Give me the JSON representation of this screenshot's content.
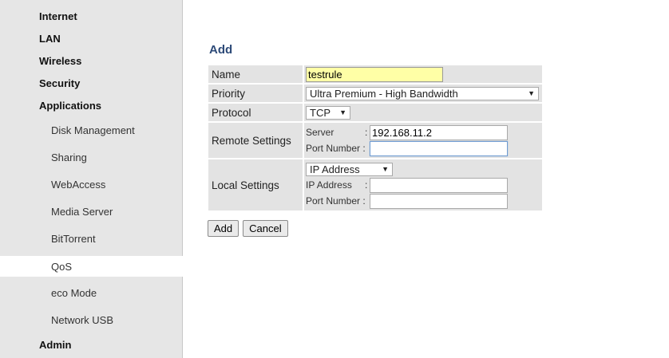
{
  "sidebar": {
    "items": [
      {
        "label": "Internet",
        "level": "top"
      },
      {
        "label": "LAN",
        "level": "top"
      },
      {
        "label": "Wireless",
        "level": "top"
      },
      {
        "label": "Security",
        "level": "top"
      },
      {
        "label": "Applications",
        "level": "top"
      },
      {
        "label": "Disk Management",
        "level": "sub"
      },
      {
        "label": "Sharing",
        "level": "sub"
      },
      {
        "label": "WebAccess",
        "level": "sub"
      },
      {
        "label": "Media Server",
        "level": "sub"
      },
      {
        "label": "BitTorrent",
        "level": "sub"
      },
      {
        "label": "QoS",
        "level": "sub",
        "active": true
      },
      {
        "label": "eco Mode",
        "level": "sub"
      },
      {
        "label": "Network USB",
        "level": "sub"
      },
      {
        "label": "Admin",
        "level": "top"
      }
    ]
  },
  "main": {
    "title": "Add",
    "form": {
      "name": {
        "label": "Name",
        "value": "testrule"
      },
      "priority": {
        "label": "Priority",
        "value": "Ultra Premium - High Bandwidth"
      },
      "protocol": {
        "label": "Protocol",
        "value": "TCP"
      },
      "remote": {
        "label": "Remote Settings",
        "server_label": "Server",
        "server_value": "192.168.11.2",
        "port_label": "Port Number :",
        "port_value": ""
      },
      "local": {
        "label": "Local Settings",
        "mode_value": "IP Address",
        "ip_label": "IP Address",
        "ip_value": "",
        "port_label": "Port Number :",
        "port_value": ""
      }
    },
    "buttons": {
      "add": "Add",
      "cancel": "Cancel"
    }
  },
  "colors": {
    "sidebar_bg": "#e6e6e6",
    "title": "#2d4a78",
    "name_field_bg": "#ffffa6",
    "table_cell_bg": "#e3e3e3"
  },
  "icons": {
    "dropdown": "chevron-down-icon"
  }
}
